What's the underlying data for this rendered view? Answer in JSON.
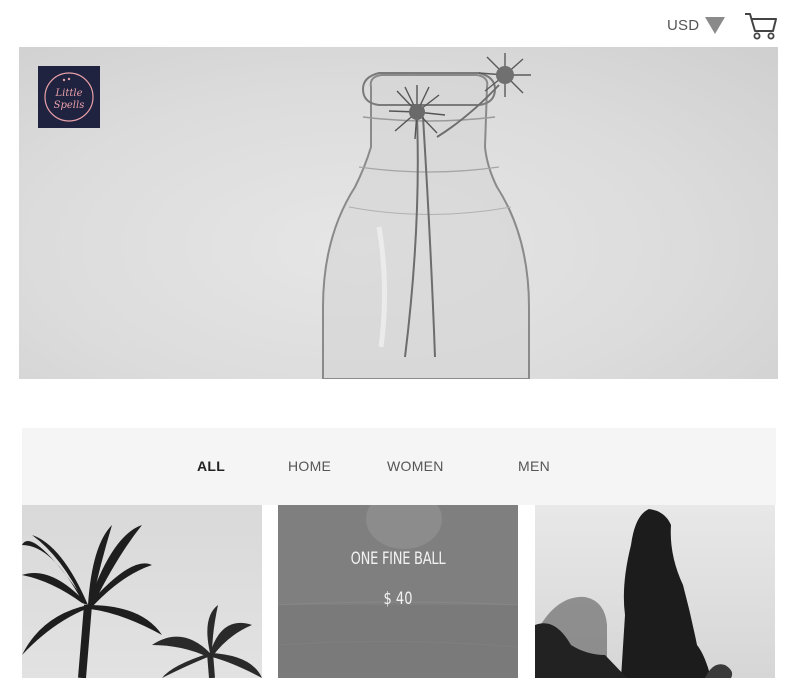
{
  "header": {
    "currency": "USD",
    "currency_icon": "caret-down-icon",
    "cart_icon": "shopping-cart-icon"
  },
  "hero": {
    "logo_text_line1": "Little",
    "logo_text_line2": "Spells",
    "image_subject": "glass bottle with dried flowers"
  },
  "filters": {
    "tabs": [
      {
        "label": "ALL",
        "active": true
      },
      {
        "label": "HOME",
        "active": false
      },
      {
        "label": "WOMEN",
        "active": false
      },
      {
        "label": "MEN",
        "active": false
      }
    ]
  },
  "products": [
    {
      "image": "palm trees"
    },
    {
      "name": "ONE FINE BALL",
      "price": "$ 40",
      "image": "ball over water"
    },
    {
      "image": "rock spire in fog"
    }
  ],
  "colors": {
    "logo_bg": "#1f2340",
    "logo_accent": "#e9a0a8",
    "filter_bg": "#f5f5f5",
    "hover_overlay": "#7f7f7f"
  }
}
